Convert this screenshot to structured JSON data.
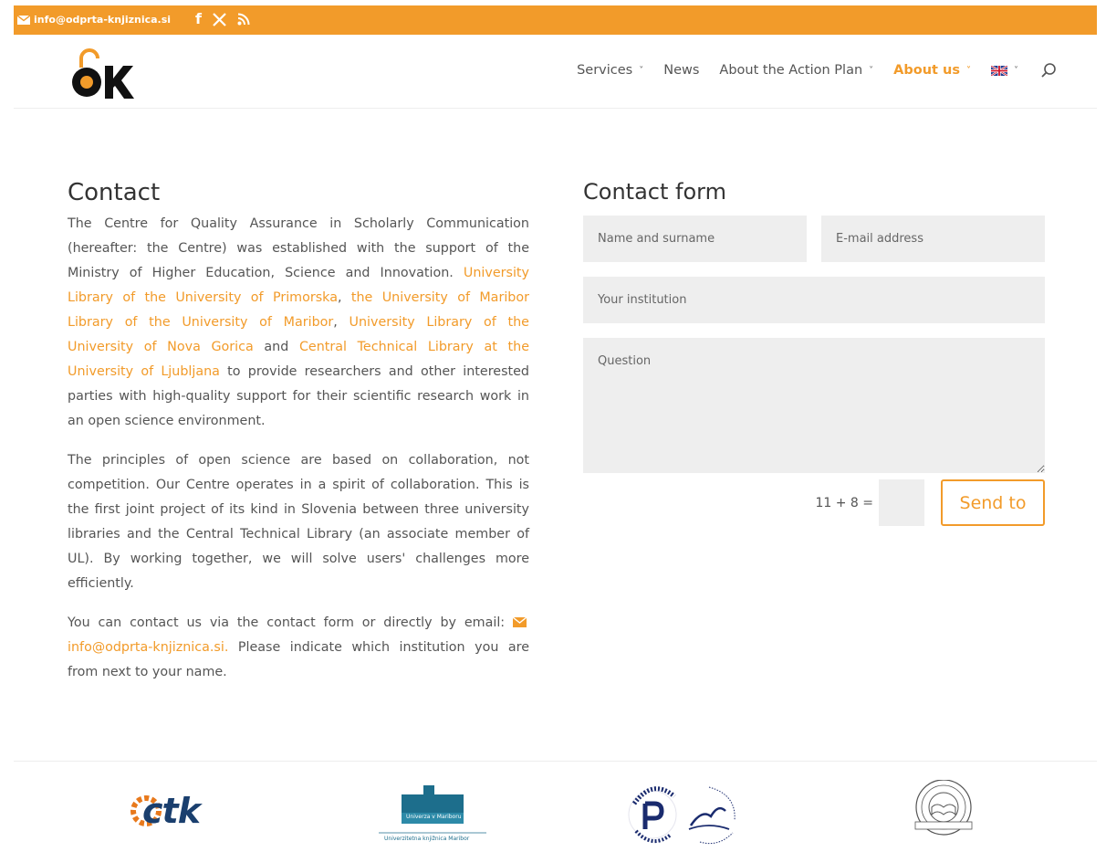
{
  "topbar": {
    "email": "info@odprta-knjiznica.si",
    "social": [
      "facebook-icon",
      "x-icon",
      "rss-icon"
    ]
  },
  "brand": {
    "logo_text": "OK",
    "accent": "#f29b2a"
  },
  "nav": {
    "items": [
      {
        "label": "Services",
        "has_dropdown": true
      },
      {
        "label": "News",
        "has_dropdown": false
      },
      {
        "label": "About the Action Plan",
        "has_dropdown": true
      },
      {
        "label": "About us",
        "has_dropdown": true,
        "active": true
      }
    ],
    "language_icon": "uk-flag-icon",
    "search_icon": "search-icon"
  },
  "contact": {
    "title": "Contact",
    "p1_intro": "The Centre for Quality Assurance in Scholarly Communication (hereafter: the Centre) was established with the support of the Ministry of Higher Education, Science and Innovation. ",
    "p1_link1": "University Library of the University of Primorska",
    "p1_sep1": ", ",
    "p1_link2": "the University of Maribor Library of the University of Maribor",
    "p1_sep2": ", ",
    "p1_link3": "University Library of the University of Nova Gorica",
    "p1_sep3": " and ",
    "p1_link4": "Central Technical Library at the University of Ljubljana",
    "p1_end": " to provide researchers and other interested parties with high-quality support for their scientific research work in an open science environment.",
    "p2": "The principles of open science are based on collaboration, not competition. Our Centre operates in a spirit of collaboration. This is the first joint project of its kind in Slovenia between three university libraries and the Central Technical Library (an associate member of UL). By working together, we will solve users' challenges more efficiently.",
    "p3_start": "You can contact us via the contact form or directly by email: ",
    "p3_email": "info@odprta-knjiznica.si.",
    "p3_end": " Please indicate which institution you are from next to your name."
  },
  "form": {
    "title": "Contact form",
    "name_placeholder": "Name and surname",
    "email_placeholder": "E-mail address",
    "institution_placeholder": "Your institution",
    "question_placeholder": "Question",
    "captcha_label": "11 + 8 =",
    "send_label": "Send to"
  },
  "footer": {
    "logos": [
      "ctk-logo",
      "univerza-v-mariboru-logo",
      "univerza-na-primorskem-logo",
      "univerza-v-novi-gorici-logo"
    ],
    "ctk_text": "ctk",
    "um_text": "Univerza v Mariboru",
    "um_sub": "Univerzitetna knjižnica Maribor"
  }
}
